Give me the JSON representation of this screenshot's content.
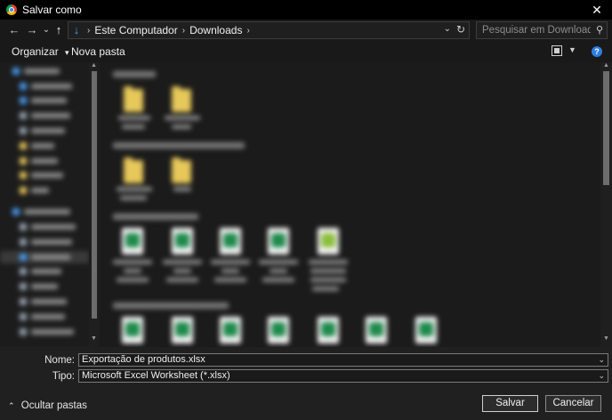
{
  "window": {
    "title": "Salvar como",
    "close_glyph": "✕"
  },
  "nav": {
    "back_glyph": "←",
    "forward_glyph": "→",
    "recent_glyph": "⌄",
    "up_glyph": "↑",
    "path": [
      "Este Computador",
      "Downloads"
    ],
    "separator": "›"
  },
  "search": {
    "placeholder": "Pesquisar em Downloads",
    "value": ""
  },
  "toolbar": {
    "organize_label": "Organizar",
    "organize_caret": "▾",
    "new_folder_label": "Nova pasta",
    "help_glyph": "?"
  },
  "form": {
    "name_label": "Nome:",
    "name_value": "Exportação de produtos.xlsx",
    "type_label": "Tipo:",
    "type_value": "Microsoft Excel Worksheet (*.xlsx)",
    "chevron": "⌄"
  },
  "footer": {
    "hide_folders_label": "Ocultar pastas",
    "hide_caret": "⌃",
    "save_label": "Salvar",
    "cancel_label": "Cancelar"
  },
  "colors": {
    "accent": "#4a9cf0",
    "folder": "#e7c85b",
    "excel": "#1f8a4c",
    "background": "#191919"
  },
  "icons": {
    "app": "chrome-icon",
    "location": "downloads-arrow-icon",
    "refresh": "refresh-icon",
    "search": "search-icon",
    "view": "view-options-icon",
    "help": "help-icon"
  }
}
